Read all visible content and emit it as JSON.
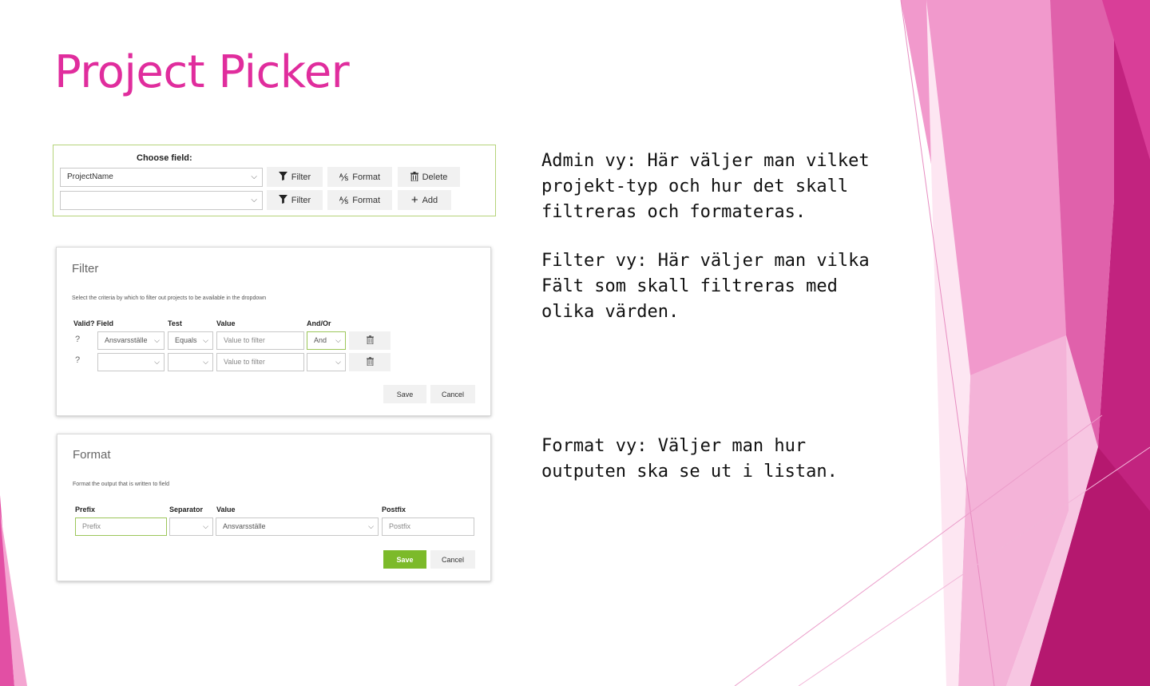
{
  "slide": {
    "title": "Project Picker",
    "descriptions": [
      "Admin vy: Här väljer man vilket projekt-typ och hur det skall filtreras och formateras.",
      "Filter vy: Här väljer man vilka Fält som skall filtreras med olika värden.",
      "Format vy: Väljer man hur outputen ska se ut i listan."
    ],
    "accent_color": "#e02d9d"
  },
  "admin": {
    "choose_field_label": "Choose field:",
    "rows": [
      {
        "field_value": "ProjectName",
        "filter_label": "Filter",
        "format_label": "Format",
        "action_label": "Delete",
        "action_icon": "trash-icon"
      },
      {
        "field_value": "",
        "filter_label": "Filter",
        "format_label": "Format",
        "action_label": "Add",
        "action_icon": "plus-icon"
      }
    ]
  },
  "filter": {
    "title": "Filter",
    "subtitle": "Select the criteria by which to filter out projects to be available in the dropdown",
    "headers": {
      "valid_field": "Valid? Field",
      "test": "Test",
      "value": "Value",
      "and_or": "And/Or"
    },
    "rows": [
      {
        "valid": "?",
        "field": "Ansvarsställe",
        "test": "Equals",
        "value_placeholder": "Value to filter",
        "and_or": "And"
      },
      {
        "valid": "?",
        "field": "",
        "test": "",
        "value_placeholder": "Value to filter",
        "and_or": ""
      }
    ],
    "save_label": "Save",
    "cancel_label": "Cancel"
  },
  "format": {
    "title": "Format",
    "subtitle": "Format the output that is written to field",
    "headers": {
      "prefix": "Prefix",
      "separator": "Separator",
      "value": "Value",
      "postfix": "Postfix"
    },
    "prefix_placeholder": "Prefix",
    "separator_value": "",
    "value_selected": "Ansvarsställe",
    "postfix_placeholder": "Postfix",
    "save_label": "Save",
    "cancel_label": "Cancel"
  }
}
